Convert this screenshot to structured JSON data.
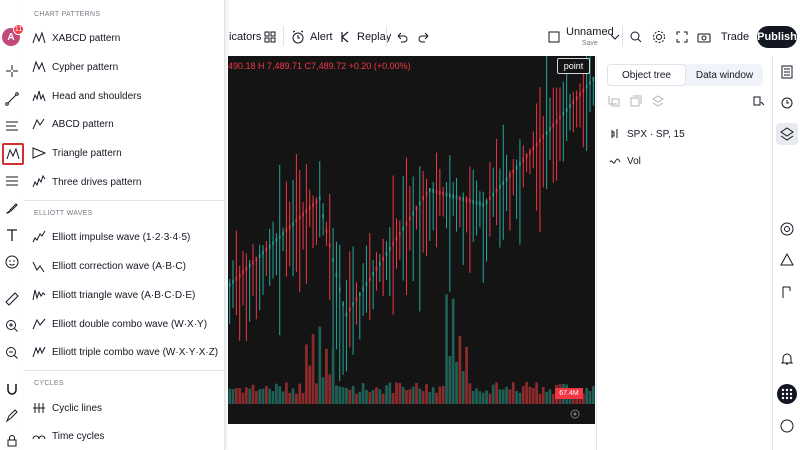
{
  "topbar": {
    "indicators_partial": "icators",
    "alert_label": "Alert",
    "replay_label": "Replay",
    "layout_name": "Unnamed",
    "layout_status": "Save",
    "trade_label": "Trade",
    "publish_label": "Publish"
  },
  "avatar": {
    "initial": "A",
    "badge_count": "11"
  },
  "dropdown": {
    "chart_patterns_title": "CHART PATTERNS",
    "chart_patterns": [
      {
        "label": "XABCD pattern",
        "icon": "xabcd-icon"
      },
      {
        "label": "Cypher pattern",
        "icon": "cypher-icon"
      },
      {
        "label": "Head and shoulders",
        "icon": "head-shoulders-icon"
      },
      {
        "label": "ABCD pattern",
        "icon": "abcd-icon"
      },
      {
        "label": "Triangle pattern",
        "icon": "triangle-icon"
      },
      {
        "label": "Three drives pattern",
        "icon": "three-drives-icon"
      }
    ],
    "elliott_title": "ELLIOTT WAVES",
    "elliott": [
      {
        "label": "Elliott impulse wave (1·2·3·4·5)",
        "icon": "impulse-wave-icon"
      },
      {
        "label": "Elliott correction wave (A·B·C)",
        "icon": "correction-wave-icon"
      },
      {
        "label": "Elliott triangle wave (A·B·C·D·E)",
        "icon": "triangle-wave-icon"
      },
      {
        "label": "Elliott double combo wave (W·X·Y)",
        "icon": "double-combo-icon"
      },
      {
        "label": "Elliott triple combo wave (W·X·Y·X·Z)",
        "icon": "triple-combo-icon"
      }
    ],
    "cycles_title": "CYCLES",
    "cycles": [
      {
        "label": "Cyclic lines",
        "icon": "cyclic-lines-icon"
      },
      {
        "label": "Time cycles",
        "icon": "time-cycles-icon"
      }
    ]
  },
  "chart": {
    "ohlc_text": "490.18 H 7,489.71 C7,489.72 +0.20 (+0.00%)",
    "symbol_tag": "point",
    "volume_tag": "67.4M",
    "colors": {
      "up": "#26a69a",
      "down": "#f23645",
      "vol_up": "#1f5f55",
      "vol_down": "#8c2b2b",
      "bg": "#141414"
    }
  },
  "object_tree": {
    "tab_object_tree": "Object tree",
    "tab_data_window": "Data window",
    "symbol_row": "SPX · SP, 15",
    "vol_row": "Vol"
  }
}
